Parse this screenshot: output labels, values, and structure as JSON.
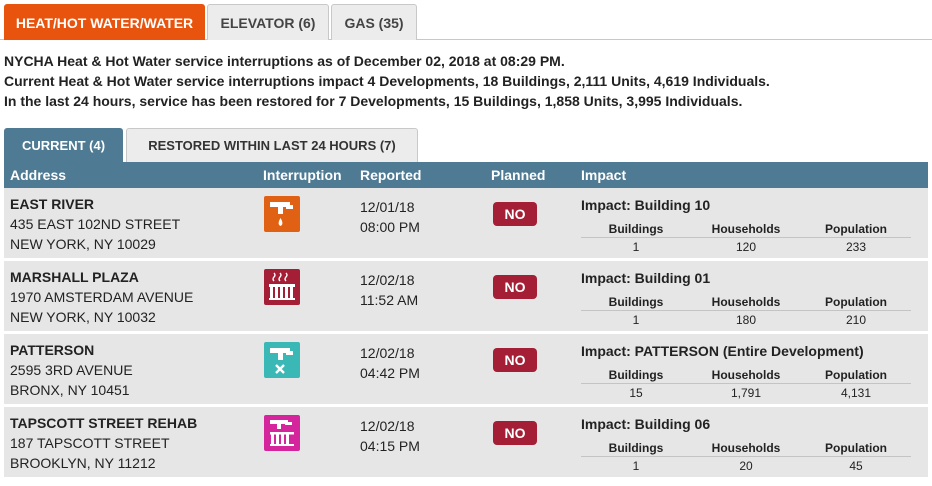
{
  "tabs": [
    {
      "label": "HEAT/HOT WATER/WATER",
      "active": true
    },
    {
      "label": "ELEVATOR (6)",
      "active": false
    },
    {
      "label": "GAS (35)",
      "active": false
    }
  ],
  "summary": {
    "line1": "NYCHA Heat & Hot Water service interruptions as of December 02, 2018 at 08:29 PM.",
    "line2": "Current Heat & Hot Water service interruptions impact 4 Developments, 18 Buildings, 2,111 Units, 4,619 Individuals.",
    "line3": "In the last 24 hours, service has been restored for 7 Developments, 15 Buildings, 1,858 Units, 3,995 Individuals."
  },
  "subtabs": [
    {
      "label": "CURRENT (4)",
      "active": true
    },
    {
      "label": "RESTORED WITHIN LAST 24 HOURS (7)",
      "active": false
    }
  ],
  "columns": {
    "address": "Address",
    "interruption": "Interruption",
    "reported": "Reported",
    "planned": "Planned",
    "impact": "Impact"
  },
  "impact_columns": {
    "buildings": "Buildings",
    "households": "Households",
    "population": "Population"
  },
  "colors": {
    "active_tab": "#e8540e",
    "header": "#4e7a93",
    "badge": "#a41f35",
    "icon_hotwater": "#e06114",
    "icon_heat": "#a41f35",
    "icon_coldwater": "#3ab8b5",
    "icon_heatwater": "#d4259d"
  },
  "rows": [
    {
      "development": "EAST RIVER",
      "street": "435 EAST 102ND STREET",
      "city": "NEW YORK, NY 10029",
      "icon": "hot-water-icon",
      "date": "12/01/18",
      "time": "08:00 PM",
      "planned": "NO",
      "impact_title": "Impact: Building 10",
      "buildings": "1",
      "households": "120",
      "population": "233"
    },
    {
      "development": "MARSHALL PLAZA",
      "street": "1970 AMSTERDAM AVENUE",
      "city": "NEW YORK, NY 10032",
      "icon": "heat-icon",
      "date": "12/02/18",
      "time": "11:52 AM",
      "planned": "NO",
      "impact_title": "Impact: Building 01",
      "buildings": "1",
      "households": "180",
      "population": "210"
    },
    {
      "development": "PATTERSON",
      "street": "2595 3RD AVENUE",
      "city": "BRONX, NY 10451",
      "icon": "water-off-icon",
      "date": "12/02/18",
      "time": "04:42 PM",
      "planned": "NO",
      "impact_title": "Impact: PATTERSON (Entire Development)",
      "buildings": "15",
      "households": "1,791",
      "population": "4,131"
    },
    {
      "development": "TAPSCOTT STREET REHAB",
      "street": "187 TAPSCOTT STREET",
      "city": "BROOKLYN, NY 11212",
      "icon": "heat-hot-water-icon",
      "date": "12/02/18",
      "time": "04:15 PM",
      "planned": "NO",
      "impact_title": "Impact: Building 06",
      "buildings": "1",
      "households": "20",
      "population": "45"
    }
  ]
}
